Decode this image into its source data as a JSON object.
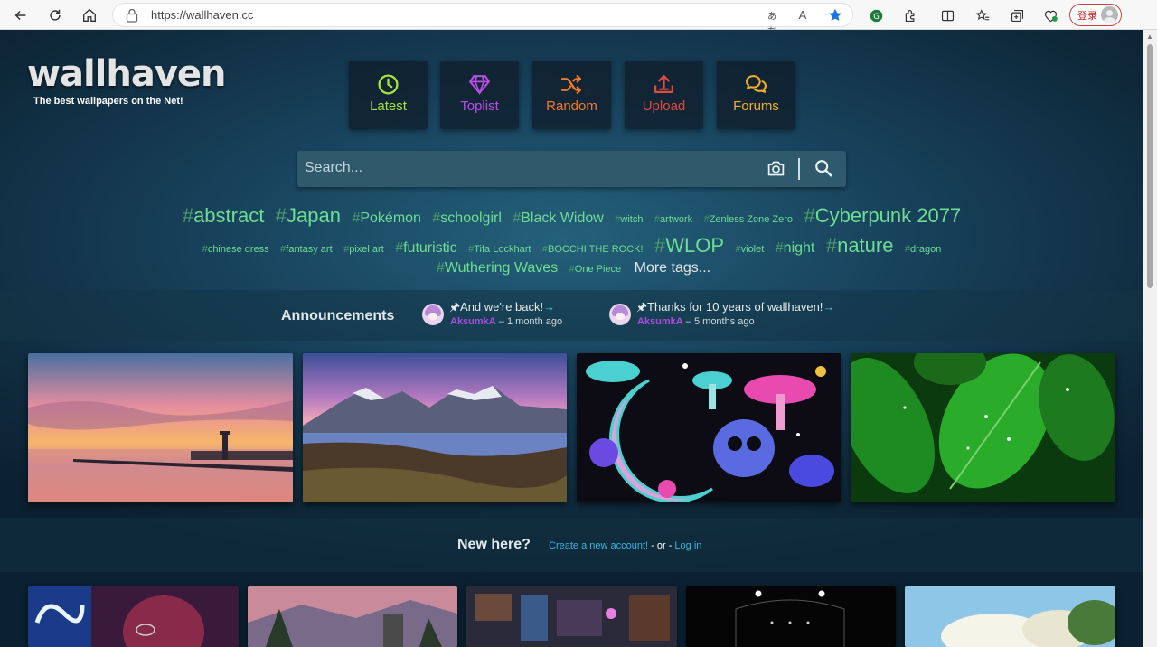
{
  "browser": {
    "url": "https://wallhaven.cc",
    "login_label": "登录",
    "read_aloud_label": "ぁあ",
    "text_size_label": "A"
  },
  "site": {
    "logo": "wallhaven",
    "tagline": "The best wallpapers on the Net!"
  },
  "nav": [
    {
      "label": "Latest",
      "icon": "clock-icon",
      "color": "#a6e23a"
    },
    {
      "label": "Toplist",
      "icon": "diamond-icon",
      "color": "#b84ee6"
    },
    {
      "label": "Random",
      "icon": "shuffle-icon",
      "color": "#f07a2a"
    },
    {
      "label": "Upload",
      "icon": "upload-icon",
      "color": "#e04a40"
    },
    {
      "label": "Forums",
      "icon": "chat-icon",
      "color": "#f2b02a"
    }
  ],
  "search": {
    "placeholder": "Search..."
  },
  "tags": {
    "row1": [
      {
        "name": "abstract",
        "size": "t4"
      },
      {
        "name": "Japan",
        "size": "t4"
      },
      {
        "name": "Pokémon",
        "size": "t3"
      },
      {
        "name": "schoolgirl",
        "size": "t3"
      },
      {
        "name": "Black Widow",
        "size": "t3"
      },
      {
        "name": "witch",
        "size": "t1"
      },
      {
        "name": "artwork",
        "size": "t1"
      },
      {
        "name": "Zenless Zone Zero",
        "size": "t1"
      },
      {
        "name": "Cyberpunk 2077",
        "size": "t4"
      }
    ],
    "row2": [
      {
        "name": "chinese dress",
        "size": "t1"
      },
      {
        "name": "fantasy art",
        "size": "t1"
      },
      {
        "name": "pixel art",
        "size": "t1"
      },
      {
        "name": "futuristic",
        "size": "t3"
      },
      {
        "name": "Tifa Lockhart",
        "size": "t1"
      },
      {
        "name": "BOCCHI THE ROCK!",
        "size": "t1"
      },
      {
        "name": "WLOP",
        "size": "t4"
      },
      {
        "name": "violet",
        "size": "t1"
      },
      {
        "name": "night",
        "size": "t3"
      },
      {
        "name": "nature",
        "size": "t4"
      },
      {
        "name": "dragon",
        "size": "t1"
      }
    ],
    "row3": [
      {
        "name": "Wuthering Waves",
        "size": "t3"
      },
      {
        "name": "One Piece",
        "size": "t1"
      }
    ],
    "more_label": "More tags..."
  },
  "announcements": {
    "title": "Announcements",
    "items": [
      {
        "pin": "🖈",
        "text": "And we're back!",
        "arrow": "→",
        "author": "AksumkA",
        "time": " – 1 month ago"
      },
      {
        "pin": "🖈",
        "text": "Thanks for 10 years of wallhaven!",
        "arrow": "→",
        "author": "AksumkA",
        "time": " – 5 months ago"
      }
    ]
  },
  "new_here": {
    "title": "New here?",
    "create_label": "Create a new account!",
    "or_label": " - or - ",
    "login_label": "Log in"
  }
}
